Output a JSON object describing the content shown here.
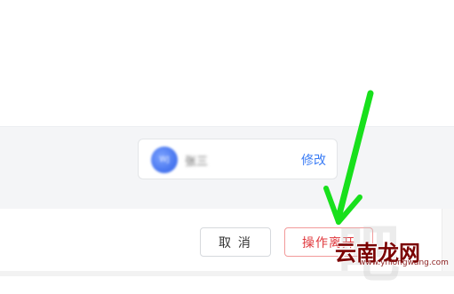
{
  "user_card": {
    "avatar_initials": "WJ",
    "name": "张三",
    "edit_label": "修改"
  },
  "footer": {
    "cancel_label": "取 消",
    "leave_label": "操作离开"
  },
  "watermark": {
    "text": "云南龙网",
    "site": "www.ynlongwang.com"
  },
  "colors": {
    "link_blue": "#3a7cf5",
    "danger_red": "#e0393e",
    "arrow_green": "#18e01c"
  }
}
